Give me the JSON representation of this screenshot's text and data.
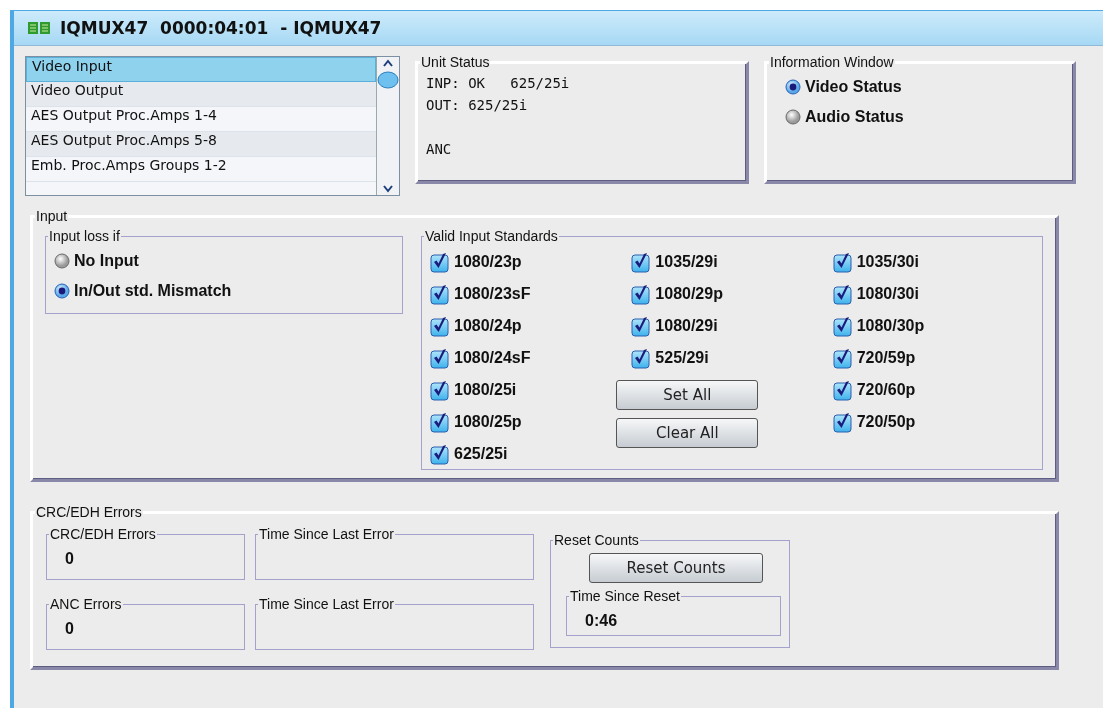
{
  "window": {
    "title": "IQMUX47  0000:04:01  - IQMUX47"
  },
  "page_list": {
    "items": [
      {
        "label": "Video Input",
        "selected": true
      },
      {
        "label": "Video Output",
        "selected": false
      },
      {
        "label": "AES Output Proc.Amps 1-4",
        "selected": false
      },
      {
        "label": "AES Output Proc.Amps 5-8",
        "selected": false
      },
      {
        "label": "Emb. Proc.Amps Groups 1-2",
        "selected": false
      }
    ]
  },
  "unit_status": {
    "title": "Unit Status",
    "lines": [
      "INP: OK   625/25i",
      "OUT: 625/25i"
    ],
    "footer_line": "ANC"
  },
  "information_window": {
    "title": "Information Window",
    "options": [
      {
        "label": "Video Status",
        "selected": true
      },
      {
        "label": "Audio Status",
        "selected": false
      }
    ]
  },
  "input": {
    "title": "Input",
    "loss_group": {
      "title": "Input  loss if",
      "options": [
        {
          "label": "No Input",
          "selected": false
        },
        {
          "label": "In/Out std. Mismatch",
          "selected": true
        }
      ]
    },
    "standards": {
      "title": "Valid Input Standards",
      "columns": [
        [
          {
            "label": "1080/23p",
            "checked": true
          },
          {
            "label": "1080/23sF",
            "checked": true
          },
          {
            "label": "1080/24p",
            "checked": true
          },
          {
            "label": "1080/24sF",
            "checked": true
          },
          {
            "label": "1080/25i",
            "checked": true
          },
          {
            "label": "1080/25p",
            "checked": true
          },
          {
            "label": "625/25i",
            "checked": true
          }
        ],
        [
          {
            "label": "1035/29i",
            "checked": true
          },
          {
            "label": "1080/29p",
            "checked": true
          },
          {
            "label": "1080/29i",
            "checked": true
          },
          {
            "label": "525/29i",
            "checked": true
          }
        ],
        [
          {
            "label": "1035/30i",
            "checked": true
          },
          {
            "label": "1080/30i",
            "checked": true
          },
          {
            "label": "1080/30p",
            "checked": true
          },
          {
            "label": "720/59p",
            "checked": true
          },
          {
            "label": "720/60p",
            "checked": true
          },
          {
            "label": "720/50p",
            "checked": true
          }
        ]
      ],
      "buttons": [
        "Set All",
        "Clear All"
      ]
    }
  },
  "errors": {
    "title": "CRC/EDH Errors",
    "rows": [
      {
        "counter_title": "CRC/EDH Errors",
        "count": "0",
        "time_title": "Time Since Last Error"
      },
      {
        "counter_title": "ANC Errors",
        "count": "0",
        "time_title": "Time Since Last Error"
      }
    ],
    "reset": {
      "title": "Reset Counts",
      "button": "Reset Counts",
      "time_title": "Time Since Reset",
      "time_value": "0:46"
    }
  }
}
